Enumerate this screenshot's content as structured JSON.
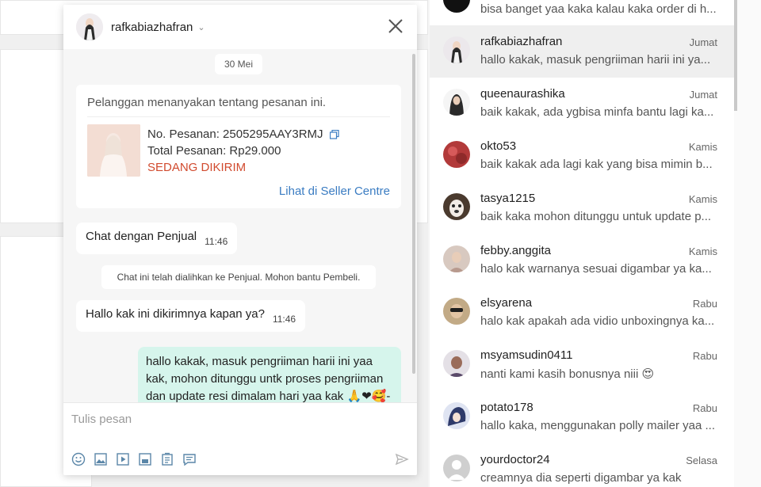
{
  "chat": {
    "username": "rafkabiazhafran",
    "date_label": "30 Mei",
    "order": {
      "question": "Pelanggan menanyakan tentang pesanan ini.",
      "order_no": "No. Pesanan: 2505295AAY3RMJ",
      "total": "Total Pesanan: Rp29.000",
      "status": "SEDANG DIKIRIM",
      "status_color": "#d14a2e",
      "link": "Lihat di Seller Centre"
    },
    "messages": [
      {
        "text": "Chat dengan Penjual",
        "time": "11:46"
      },
      {
        "text": "Hallo kak ini dikirimnya kapan ya?",
        "time": "11:46"
      }
    ],
    "system_note": "Chat ini telah dialihkan ke Penjual. Mohon bantu Pembeli.",
    "outgoing": "hallo kakak, masuk pengriiman harii ini yaa kak, mohon ditunggu untk proses pengriiman dan update resi dimalam hari yaa kak 🙏❤🥰-",
    "composer_placeholder": "Tulis pesan",
    "tools": [
      "emoji-icon",
      "image-icon",
      "video-icon",
      "product-icon",
      "order-icon",
      "quick-reply-icon"
    ]
  },
  "conversations": [
    {
      "name": "",
      "day": "",
      "preview": "bisa banget yaa kaka kalau kaka order di h...",
      "color": "#111111"
    },
    {
      "name": "rafkabiazhafran",
      "day": "Jumat",
      "preview": "hallo kakak, masuk pengriiman harii ini ya...",
      "color": "#e9e4ea",
      "active": true
    },
    {
      "name": "queenaurashika",
      "day": "Jumat",
      "preview": "baik kakak, ada ygbisa minfa bantu lagi ka...",
      "color": "#3a3a3a"
    },
    {
      "name": "okto53",
      "day": "Kamis",
      "preview": "baik kakak ada lagi kak yang bisa mimin b...",
      "color": "#b23a3a"
    },
    {
      "name": "tasya1215",
      "day": "Kamis",
      "preview": "baik kaka mohon ditunggu untuk update p...",
      "color": "#6b5a4a"
    },
    {
      "name": "febby.anggita",
      "day": "Kamis",
      "preview": "halo kak warnanya sesuai digambar ya ka...",
      "color": "#c9b3a8"
    },
    {
      "name": "elsyarena",
      "day": "Rabu",
      "preview": "halo kak apakah ada vidio unboxingnya ka...",
      "color": "#a08c70"
    },
    {
      "name": "msyamsudin0411",
      "day": "Rabu",
      "preview": "nanti kami kasih bonusnya niii 😍",
      "color": "#7b6a80"
    },
    {
      "name": "potato178",
      "day": "Rabu",
      "preview": "hallo kaka, menggunakan polly mailer yaa ...",
      "color": "#4a5a8a"
    },
    {
      "name": "yourdoctor24",
      "day": "Selasa",
      "preview": "creamnya dia seperti digambar ya kak",
      "color": "#cfcfcf"
    }
  ]
}
